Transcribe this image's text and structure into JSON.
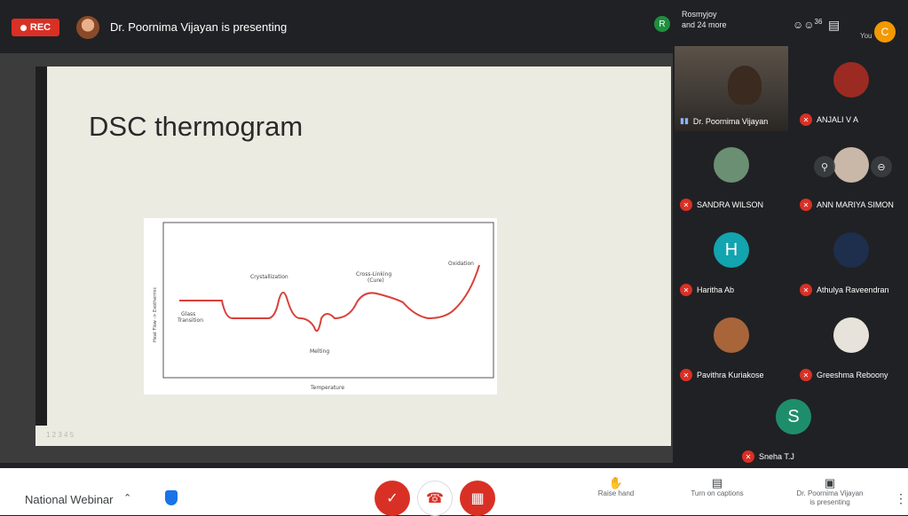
{
  "topbar": {
    "rec_label": "REC",
    "presenting_text": "Dr. Poornima Vijayan is presenting",
    "viewer_initial": "R",
    "viewer_line1": "Rosmyjoy",
    "viewer_line2": "and 24 more",
    "people_count": "36",
    "you_label": "You",
    "you_initial": "C"
  },
  "slide": {
    "title": "DSC thermogram",
    "footer": "1 2 3 4 5"
  },
  "chart_data": {
    "type": "line",
    "xlabel": "Temperature",
    "ylabel": "Heat Flow -> Exothermic",
    "annotations": [
      {
        "label": "Glass Transition",
        "line1": "Glass",
        "line2": "Transition"
      },
      {
        "label": "Crystallization"
      },
      {
        "label": "Melting"
      },
      {
        "label": "Cross-Linking (Cure)",
        "line1": "Cross-Linking",
        "line2": "(Cure)"
      },
      {
        "label": "Oxidation"
      }
    ],
    "curve_color": "#d9403a"
  },
  "participants": [
    {
      "name": "Dr. Poornima Vijayan",
      "type": "video",
      "speaking": true
    },
    {
      "name": "ANJALI V A",
      "type": "avatar",
      "muted": true,
      "color": "#9b2b22"
    },
    {
      "name": "SANDRA WILSON",
      "type": "avatar",
      "muted": true,
      "color": "#6b8f73"
    },
    {
      "name": "ANN MARIYA SIMON",
      "type": "avatar",
      "muted": true,
      "color": "#c9b7a8"
    },
    {
      "name": "Haritha Ab",
      "type": "initial",
      "initial": "H",
      "muted": true,
      "color": "#12a4af"
    },
    {
      "name": "Athulya Raveendran",
      "type": "avatar",
      "muted": true,
      "color": "#1d2f4d"
    },
    {
      "name": "Pavithra Kuriakose",
      "type": "avatar",
      "muted": true,
      "color": "#a8653a"
    },
    {
      "name": "Greeshma Reboony",
      "type": "avatar",
      "muted": true,
      "color": "#e7e2da"
    },
    {
      "name": "Sneha T.J",
      "type": "initial",
      "initial": "S",
      "muted": true,
      "color": "#1e8e6a"
    }
  ],
  "bottombar": {
    "meeting_name": "National Webinar",
    "raise_hand": "Raise hand",
    "captions": "Turn on captions",
    "presenting_line1": "Dr. Poornima Vijayan",
    "presenting_line2": "is presenting"
  },
  "icons": {
    "mic": "mic-off-icon",
    "hangup": "call-end-icon",
    "camera": "videocam-off-icon",
    "hand": "hand-icon",
    "cc": "closed-caption-icon",
    "present": "present-icon",
    "more": "more-vert-icon"
  },
  "colors": {
    "background": "#202124",
    "rec": "#d93025",
    "accent": "#1a73e8"
  }
}
